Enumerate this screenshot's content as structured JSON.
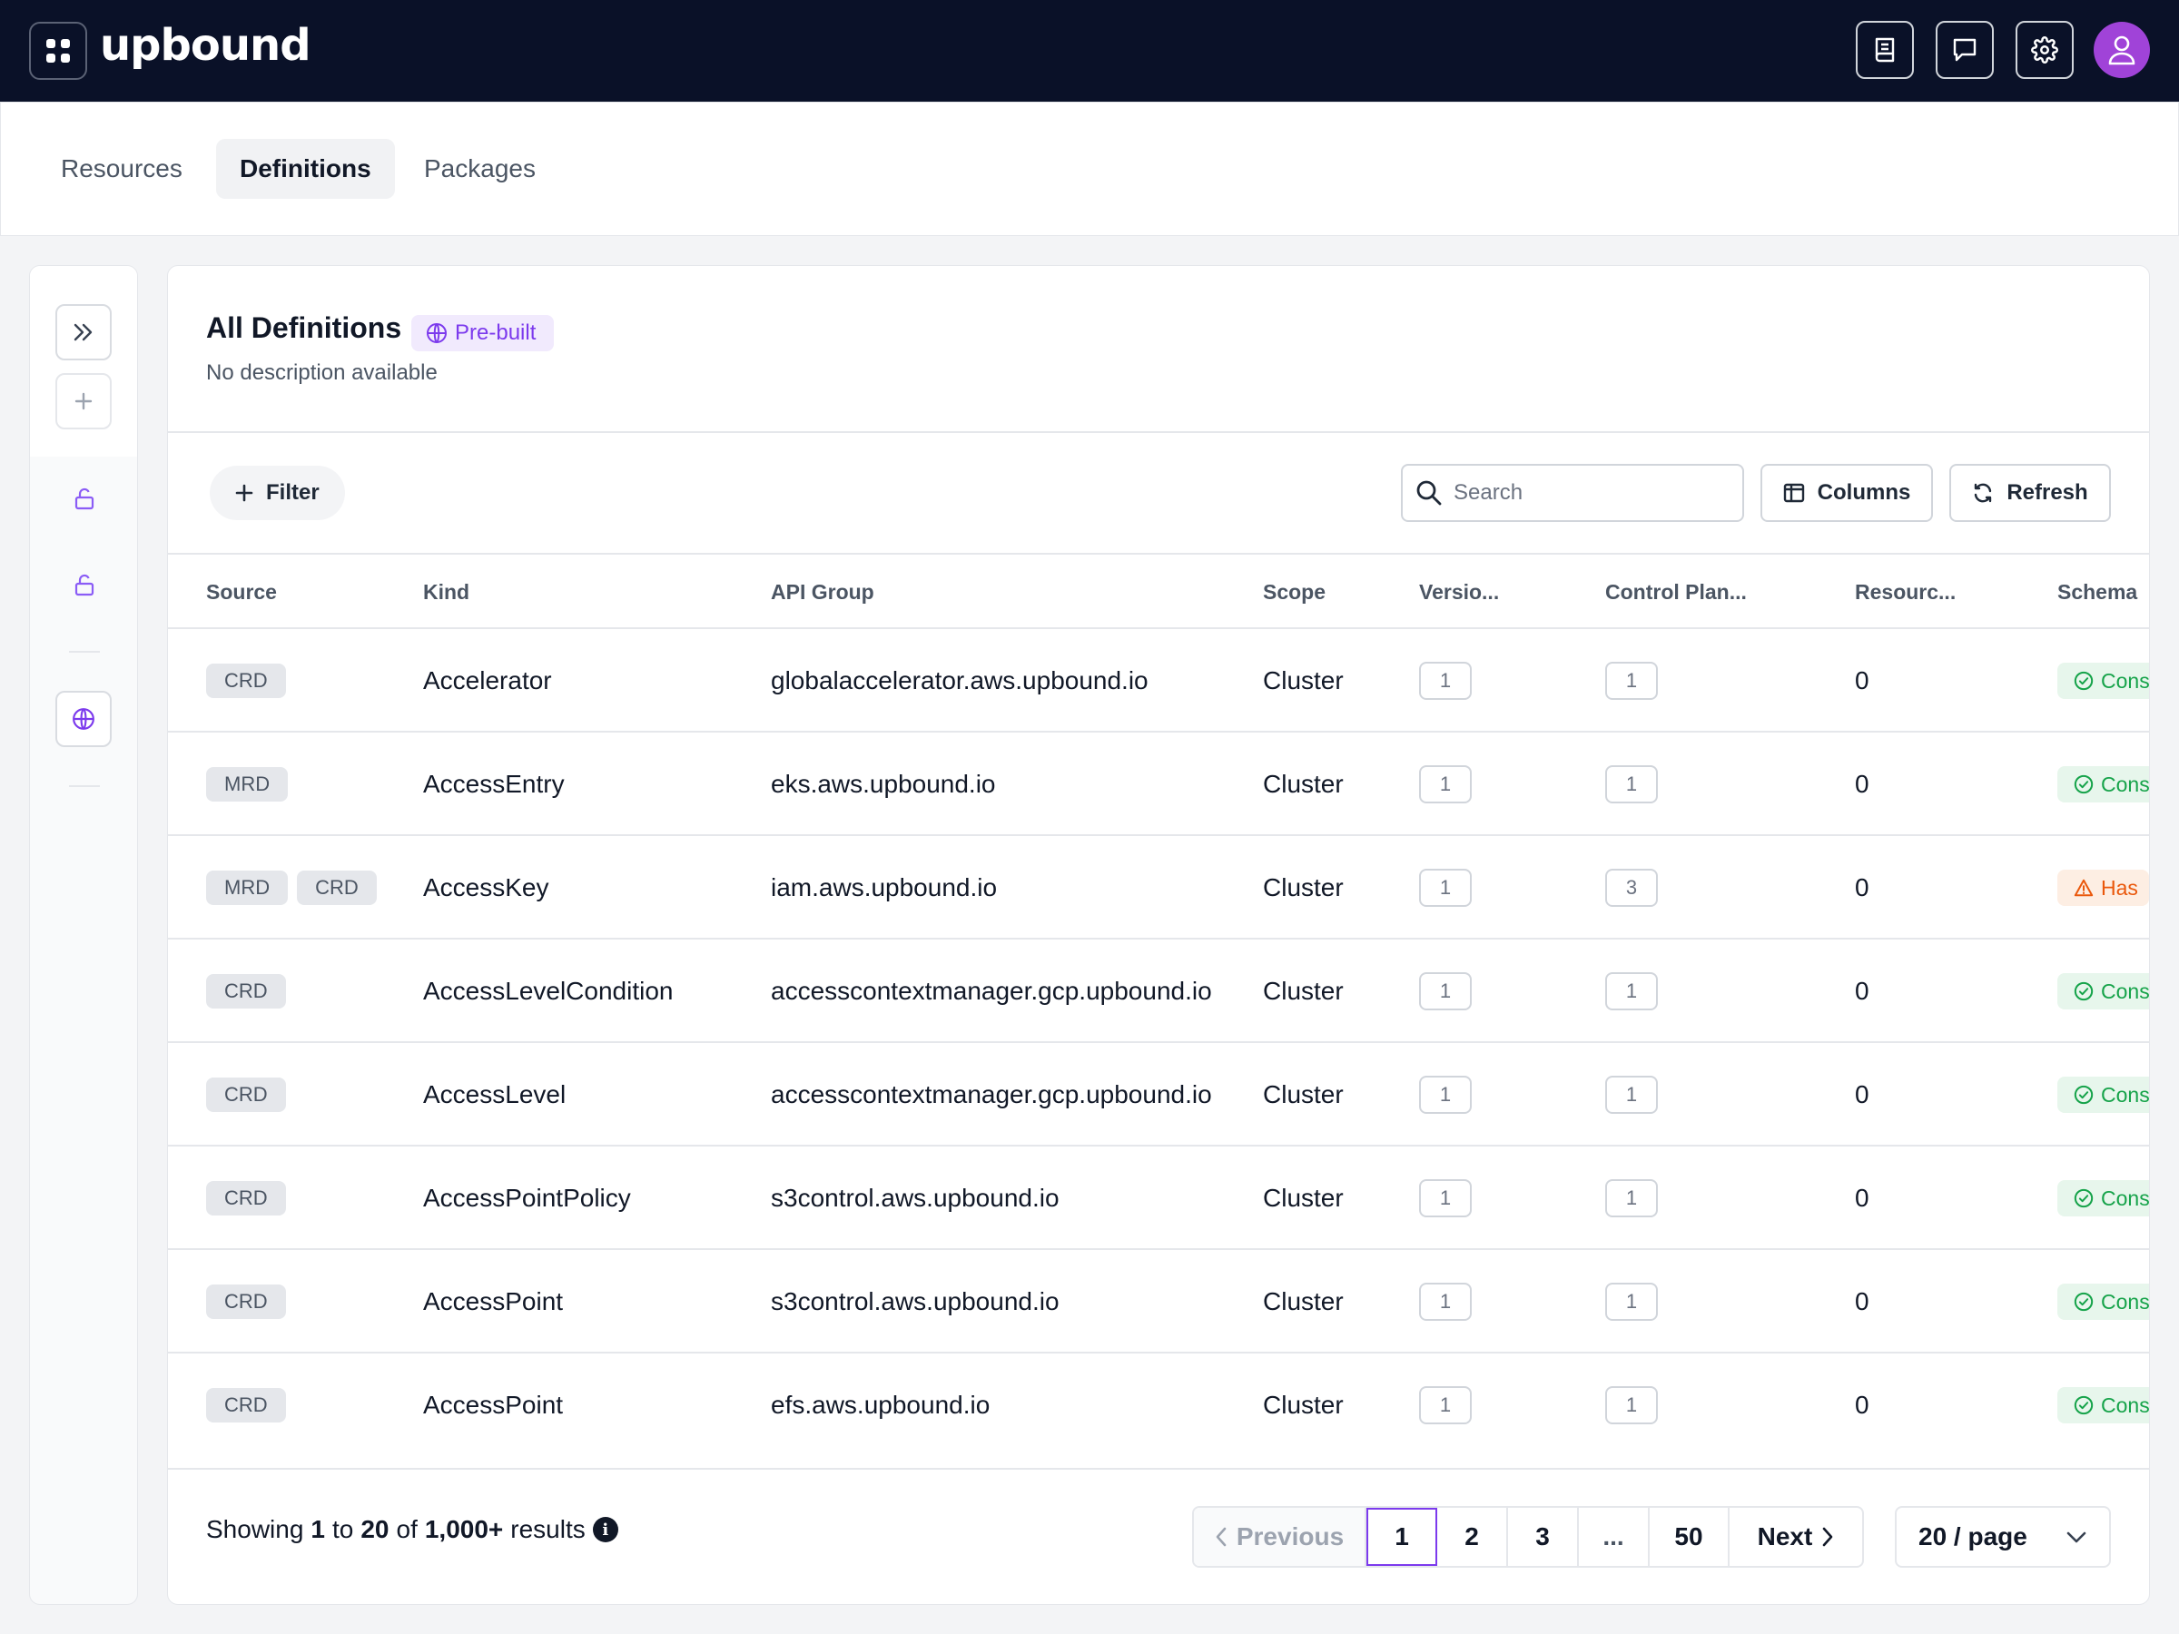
{
  "header": {
    "logo_text": "upbound",
    "icons": [
      "apps-grid-icon",
      "docs-icon",
      "chat-icon",
      "gear-icon",
      "user-icon"
    ]
  },
  "tabs": [
    {
      "label": "Resources",
      "active": false
    },
    {
      "label": "Definitions",
      "active": true
    },
    {
      "label": "Packages",
      "active": false
    }
  ],
  "rail": {
    "icons": [
      "expand-double-chevron-icon",
      "plus-icon",
      "unlock-icon",
      "unlock-icon",
      "globe-icon"
    ]
  },
  "panel": {
    "title": "All Definitions",
    "badge": "Pre-built",
    "description": "No description available"
  },
  "toolbar": {
    "filter_label": "Filter",
    "search_placeholder": "Search",
    "columns_label": "Columns",
    "refresh_label": "Refresh"
  },
  "table": {
    "columns": [
      "Source",
      "Kind",
      "API Group",
      "Scope",
      "Versio...",
      "Control Plan...",
      "Resourc...",
      "Schema"
    ],
    "rows": [
      {
        "sources": [
          "CRD"
        ],
        "kind": "Accelerator",
        "api_group": "globalaccelerator.aws.upbound.io",
        "scope": "Cluster",
        "versions": "1",
        "control_planes": "1",
        "resources": "0",
        "schema": "Cons",
        "schema_status": "ok"
      },
      {
        "sources": [
          "MRD"
        ],
        "kind": "AccessEntry",
        "api_group": "eks.aws.upbound.io",
        "scope": "Cluster",
        "versions": "1",
        "control_planes": "1",
        "resources": "0",
        "schema": "Cons",
        "schema_status": "ok"
      },
      {
        "sources": [
          "MRD",
          "CRD"
        ],
        "kind": "AccessKey",
        "api_group": "iam.aws.upbound.io",
        "scope": "Cluster",
        "versions": "1",
        "control_planes": "3",
        "resources": "0",
        "schema": "Has",
        "schema_status": "warn"
      },
      {
        "sources": [
          "CRD"
        ],
        "kind": "AccessLevelCondition",
        "api_group": "accesscontextmanager.gcp.upbound.io",
        "scope": "Cluster",
        "versions": "1",
        "control_planes": "1",
        "resources": "0",
        "schema": "Cons",
        "schema_status": "ok"
      },
      {
        "sources": [
          "CRD"
        ],
        "kind": "AccessLevel",
        "api_group": "accesscontextmanager.gcp.upbound.io",
        "scope": "Cluster",
        "versions": "1",
        "control_planes": "1",
        "resources": "0",
        "schema": "Cons",
        "schema_status": "ok"
      },
      {
        "sources": [
          "CRD"
        ],
        "kind": "AccessPointPolicy",
        "api_group": "s3control.aws.upbound.io",
        "scope": "Cluster",
        "versions": "1",
        "control_planes": "1",
        "resources": "0",
        "schema": "Cons",
        "schema_status": "ok"
      },
      {
        "sources": [
          "CRD"
        ],
        "kind": "AccessPoint",
        "api_group": "s3control.aws.upbound.io",
        "scope": "Cluster",
        "versions": "1",
        "control_planes": "1",
        "resources": "0",
        "schema": "Cons",
        "schema_status": "ok"
      },
      {
        "sources": [
          "CRD"
        ],
        "kind": "AccessPoint",
        "api_group": "efs.aws.upbound.io",
        "scope": "Cluster",
        "versions": "1",
        "control_planes": "1",
        "resources": "0",
        "schema": "Cons",
        "schema_status": "ok"
      }
    ]
  },
  "footer": {
    "showing_prefix": "Showing",
    "from": "1",
    "to_word": "to",
    "to": "20",
    "of_word": "of",
    "total": "1,000+",
    "results_word": "results",
    "pagination": {
      "previous_label": "Previous",
      "pages": [
        "1",
        "2",
        "3",
        "...",
        "50"
      ],
      "current": "1",
      "next_label": "Next"
    },
    "page_size": "20 / page"
  },
  "colors": {
    "topbar": "#0a1128",
    "accent": "#7c3aed",
    "avatar": "#a043d8",
    "schema_ok": "#16a34a",
    "schema_warn": "#ea580c"
  }
}
